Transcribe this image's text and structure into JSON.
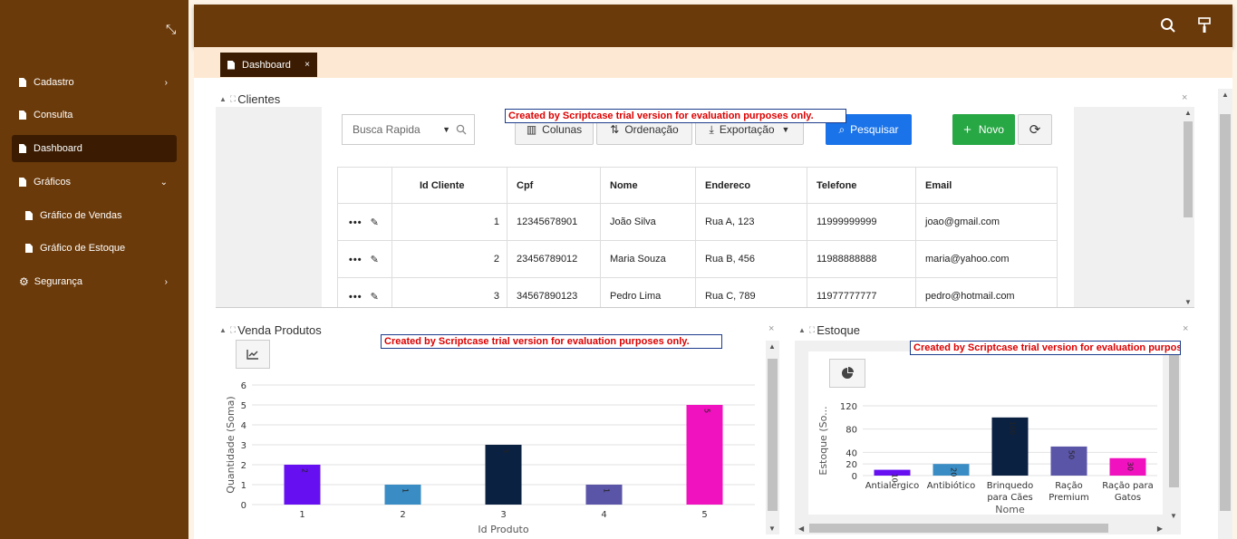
{
  "sidebar": {
    "items": [
      {
        "label": "Cadastro",
        "chevron": "›"
      },
      {
        "label": "Consulta"
      },
      {
        "label": "Dashboard"
      },
      {
        "label": "Gráficos",
        "chevron": "⌄"
      },
      {
        "label": "Gráfico de Vendas"
      },
      {
        "label": "Gráfico de Estoque"
      },
      {
        "label": "Segurança",
        "chevron": "›"
      }
    ]
  },
  "tabs": [
    {
      "label": "Dashboard",
      "close": "×"
    }
  ],
  "clientes": {
    "title": "Clientes",
    "trial_text": "Created by Scriptcase trial version for evaluation purposes only.",
    "search_placeholder": "Busca Rapida",
    "buttons": {
      "colunas": "Colunas",
      "ordenacao": "Ordenação",
      "exportacao": "Exportação",
      "pesquisar": "Pesquisar",
      "novo": "Novo"
    },
    "columns": [
      "",
      "Id Cliente",
      "Cpf",
      "Nome",
      "Endereco",
      "Telefone",
      "Email"
    ],
    "rows": [
      {
        "id": "1",
        "cpf": "12345678901",
        "nome": "João Silva",
        "endereco": "Rua A, 123",
        "telefone": "11999999999",
        "email": "joao@gmail.com"
      },
      {
        "id": "2",
        "cpf": "23456789012",
        "nome": "Maria Souza",
        "endereco": "Rua B, 456",
        "telefone": "11988888888",
        "email": "maria@yahoo.com"
      },
      {
        "id": "3",
        "cpf": "34567890123",
        "nome": "Pedro Lima",
        "endereco": "Rua C, 789",
        "telefone": "11977777777",
        "email": "pedro@hotmail.com"
      }
    ]
  },
  "vendas": {
    "title": "Venda Produtos",
    "trial_text": "Created by Scriptcase trial version for evaluation purposes only."
  },
  "estoque": {
    "title": "Estoque",
    "trial_text": "Created by Scriptcase trial version for evaluation purposes only."
  },
  "chart_data": [
    {
      "type": "bar",
      "categories": [
        "1",
        "2",
        "3",
        "4",
        "5"
      ],
      "values": [
        2,
        1,
        3,
        1,
        5
      ],
      "colors": [
        "#6610f2",
        "#3a8dc4",
        "#0b2142",
        "#5b55a8",
        "#f012be"
      ],
      "xlabel": "Id Produto",
      "ylabel": "Quantidade (Soma)",
      "ylim": [
        0,
        6
      ],
      "yticks": [
        0,
        1,
        2,
        3,
        4,
        5,
        6
      ]
    },
    {
      "type": "bar",
      "categories": [
        [
          "Antialérgico"
        ],
        [
          "Antibiótico"
        ],
        [
          "Brinquedo",
          "para Cães"
        ],
        [
          "Ração",
          "Premium"
        ],
        [
          "Ração para",
          "Gatos"
        ]
      ],
      "values": [
        10,
        20,
        100,
        50,
        30
      ],
      "colors": [
        "#6610f2",
        "#3a8dc4",
        "#0b2142",
        "#5b55a8",
        "#f012be"
      ],
      "xlabel": "Nome",
      "ylabel": "Estoque (So...",
      "ylim": [
        0,
        120
      ],
      "yticks": [
        0,
        20,
        40,
        80,
        120
      ]
    }
  ]
}
